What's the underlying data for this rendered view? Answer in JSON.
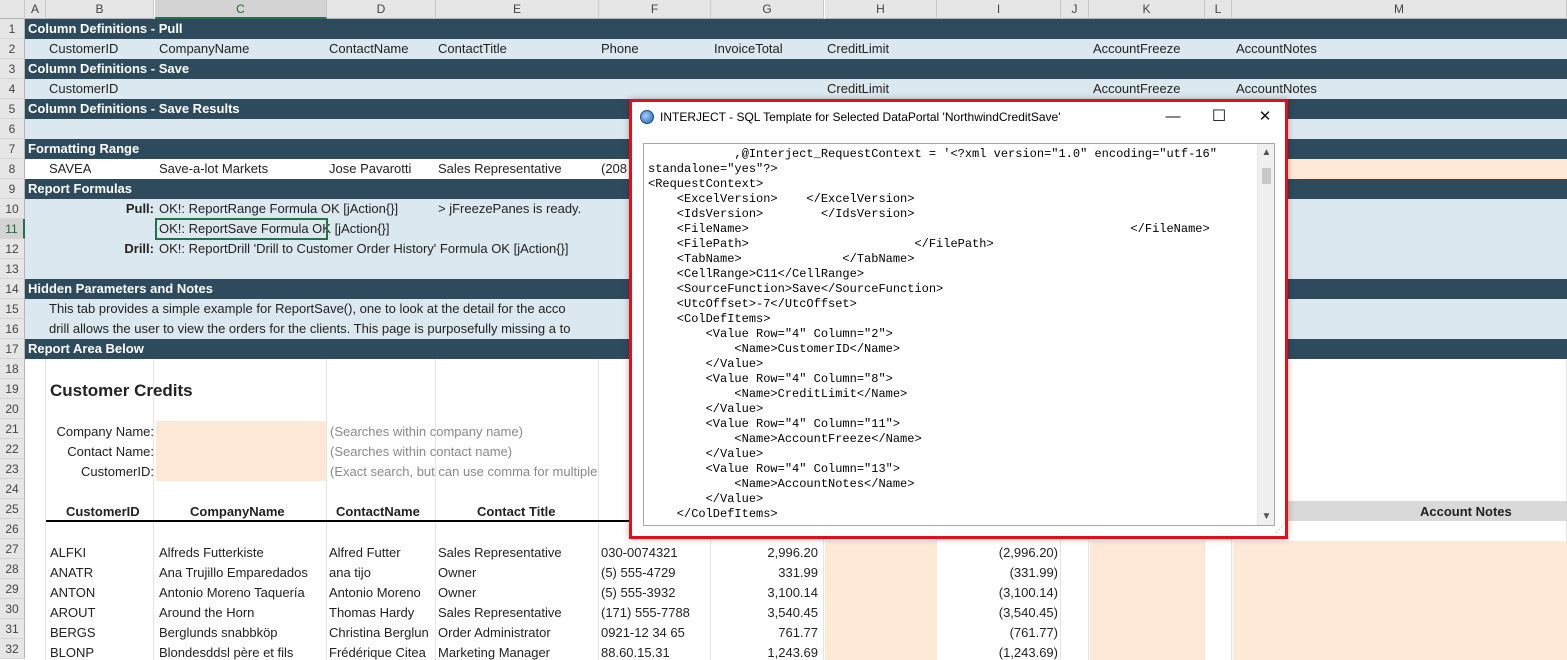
{
  "columns": [
    "A",
    "B",
    "C",
    "D",
    "E",
    "F",
    "G",
    "H",
    "I",
    "J",
    "K",
    "L",
    "M"
  ],
  "rows": [
    "1",
    "2",
    "3",
    "4",
    "5",
    "6",
    "7",
    "8",
    "9",
    "10",
    "11",
    "12",
    "13",
    "14",
    "15",
    "16",
    "17",
    "18",
    "19",
    "20",
    "21",
    "22",
    "23",
    "24",
    "25",
    "26",
    "27",
    "28",
    "29",
    "30",
    "31",
    "32"
  ],
  "bands": {
    "pull": "Column Definitions - Pull",
    "save": "Column Definitions - Save",
    "save_results": "Column Definitions - Save Results",
    "formatting": "Formatting Range",
    "formulas": "Report Formulas",
    "hidden": "Hidden Parameters and Notes",
    "report_area": "Report Area Below"
  },
  "pull_row": {
    "customerid": "CustomerID",
    "companyname": "CompanyName",
    "contactname": "ContactName",
    "contacttitle": "ContactTitle",
    "phone": "Phone",
    "invoicetotal": "InvoiceTotal",
    "creditlimit": "CreditLimit",
    "accountfreeze": "AccountFreeze",
    "accountnotes": "AccountNotes"
  },
  "save_row": {
    "customerid": "CustomerID",
    "creditlimit": "CreditLimit",
    "accountfreeze": "AccountFreeze",
    "accountnotes": "AccountNotes"
  },
  "format_row": {
    "id": "SAVEA",
    "company": "Save-a-lot Markets",
    "contact": "Jose Pavarotti",
    "title": "Sales Representative",
    "phone": "(208"
  },
  "formulas": {
    "pull_label": "Pull:",
    "pull_text": "OK!: ReportRange Formula OK [jAction{}]",
    "pull_extra": "> jFreezePanes is ready.",
    "save_text": "OK!: ReportSave Formula OK [jAction{}]",
    "drill_label": "Drill:",
    "drill_text": "OK!: ReportDrill 'Drill to Customer Order History' Formula OK [jAction{}]"
  },
  "notes": {
    "line1": "This tab provides a simple example for ReportSave(), one to look at the detail for the acco",
    "line2": "drill allows the user to view the orders for the clients.   This page is purposefully missing a to"
  },
  "report": {
    "title": "Customer Credits",
    "company_label": "Company Name:",
    "company_hint": "(Searches within company name)",
    "contact_label": "Contact Name:",
    "contact_hint": "(Searches within contact name)",
    "customerid_label": "CustomerID:",
    "customerid_hint": "(Exact search, but can use comma for multiple"
  },
  "table": {
    "headers": {
      "customerid": "CustomerID",
      "companyname": "CompanyName",
      "contactname": "ContactName",
      "contacttitle": "Contact Title",
      "accountnotes": "Account Notes"
    },
    "rows": [
      {
        "id": "ALFKI",
        "company": "Alfreds Futterkiste",
        "contact": "Alfred Futter",
        "title": "Sales Representative",
        "phone": "030-0074321",
        "total": "2,996.20",
        "neg": "(2,996.20)"
      },
      {
        "id": "ANATR",
        "company": "Ana Trujillo Emparedados",
        "contact": "ana tijo",
        "title": "Owner",
        "phone": "(5) 555-4729",
        "total": "331.99",
        "neg": "(331.99)"
      },
      {
        "id": "ANTON",
        "company": "Antonio Moreno Taquería",
        "contact": "Antonio Moreno",
        "title": "Owner",
        "phone": "(5) 555-3932",
        "total": "3,100.14",
        "neg": "(3,100.14)"
      },
      {
        "id": "AROUT",
        "company": "Around the Horn",
        "contact": "Thomas Hardy",
        "title": "Sales Representative",
        "phone": "(171) 555-7788",
        "total": "3,540.45",
        "neg": "(3,540.45)"
      },
      {
        "id": "BERGS",
        "company": "Berglunds snabbköp",
        "contact": "Christina Berglun",
        "title": "Order Administrator",
        "phone": "0921-12 34 65",
        "total": "761.77",
        "neg": "(761.77)"
      },
      {
        "id": "BLONP",
        "company": "Blondesddsl père et fils",
        "contact": "Frédérique Citea",
        "title": "Marketing Manager",
        "phone": "88.60.15.31",
        "total": "1,243.69",
        "neg": "(1,243.69)"
      }
    ]
  },
  "dialog": {
    "title": "INTERJECT - SQL Template for Selected DataPortal 'NorthwindCreditSave'",
    "minimize": "—",
    "maximize": "☐",
    "close": "✕",
    "lines": [
      "            ,@Interject_RequestContext = '<?xml version=\"1.0\" encoding=\"utf-16\"",
      "standalone=\"yes\"?>",
      "<RequestContext>",
      "    <ExcelVersion>    </ExcelVersion>",
      "    <IdsVersion>        </IdsVersion>",
      "    <FileName>                                                     </FileName>",
      "    <FilePath>                       </FilePath>",
      "    <TabName>              </TabName>",
      "    <CellRange>C11</CellRange>",
      "    <SourceFunction>Save</SourceFunction>",
      "    <UtcOffset>-7</UtcOffset>",
      "    <ColDefItems>",
      "        <Value Row=\"4\" Column=\"2\">",
      "            <Name>CustomerID</Name>",
      "        </Value>",
      "        <Value Row=\"4\" Column=\"8\">",
      "            <Name>CreditLimit</Name>",
      "        </Value>",
      "        <Value Row=\"4\" Column=\"11\">",
      "            <Name>AccountFreeze</Name>",
      "        </Value>",
      "        <Value Row=\"4\" Column=\"13\">",
      "            <Name>AccountNotes</Name>",
      "        </Value>",
      "    </ColDefItems>"
    ]
  },
  "colors": {
    "band_dark": "#2e4b5e",
    "band_light": "#dce8ef",
    "peach": "#fde9d5",
    "dialog_border": "#e0101a",
    "excel_green": "#217346"
  }
}
